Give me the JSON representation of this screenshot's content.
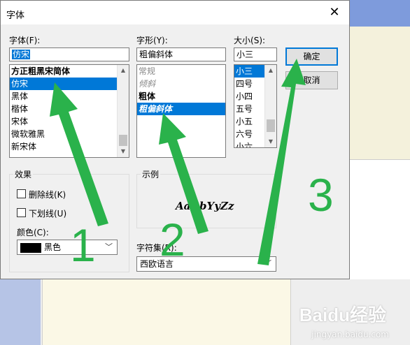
{
  "window": {
    "title": "字体",
    "close_glyph": "✕"
  },
  "font_family": {
    "label": "字体",
    "hotkey": "(F):",
    "value": "仿宋",
    "items": [
      "方正粗黑宋简体",
      "仿宋",
      "黑体",
      "楷体",
      "宋体",
      "微软雅黑",
      "新宋体"
    ],
    "selected_index": 1
  },
  "font_style": {
    "label": "字形",
    "hotkey": "(Y):",
    "value": "粗偏斜体",
    "items": [
      "常规",
      "倾斜",
      "粗体",
      "粗偏斜体"
    ],
    "selected_index": 3
  },
  "font_size": {
    "label": "大小",
    "hotkey": "(S):",
    "value": "小三",
    "items": [
      "小三",
      "四号",
      "小四",
      "五号",
      "小五",
      "六号",
      "小六"
    ],
    "selected_index": 0
  },
  "buttons": {
    "ok": "确定",
    "cancel": "取消"
  },
  "effects": {
    "title": "效果",
    "strikeout": "删除线(K)",
    "underline": "下划线(U)",
    "color_label": "颜色(C):",
    "color_value": "黑色",
    "color_hex": "#000000"
  },
  "sample": {
    "title": "示例",
    "text": "AaBbYyZz"
  },
  "charset": {
    "label": "字符集(R):",
    "value": "西欧语言"
  },
  "annotations": {
    "n1": "1",
    "n2": "2",
    "n3": "3",
    "color": "#2ab24b"
  },
  "watermark": {
    "brand": "Baidu经验",
    "sub": "jingyan.baidu.com"
  }
}
